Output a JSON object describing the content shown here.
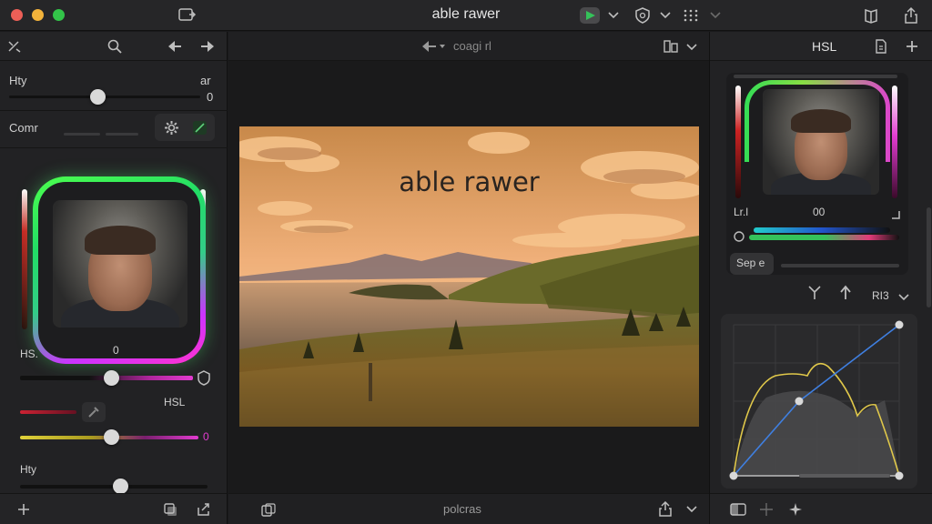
{
  "window": {
    "title": "able rawer"
  },
  "left_panel": {
    "top_slider": {
      "label": "Hty",
      "right_label": "ar",
      "value": "0"
    },
    "section2": {
      "label": "Comr"
    },
    "hsl": {
      "label": "HS.",
      "value": "0",
      "sub_label": "HSL",
      "value2": "0"
    },
    "bottom_slider": {
      "label": "Hty"
    }
  },
  "center": {
    "toolbar_label": "coagi rl",
    "photo_title": "able rawer",
    "bottom_label": "polcras"
  },
  "right_panel": {
    "header_label": "HSL",
    "readout_left": "Lr.l",
    "readout_mid": "00",
    "sep_button": "Sep e",
    "dropdown_label": "RI3"
  },
  "colors": {
    "accent_green": "#35c25a",
    "magenta": "#e23bd0",
    "yellow": "#e0d23a"
  }
}
